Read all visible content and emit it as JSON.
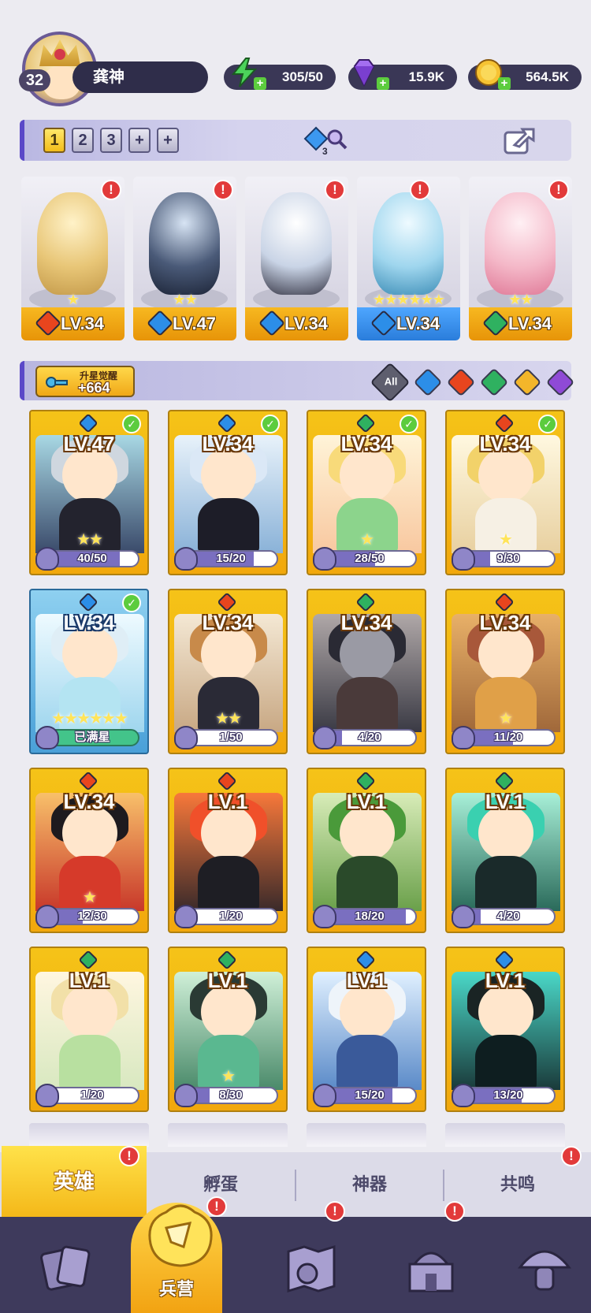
{
  "player": {
    "level": "32",
    "name": "龚神"
  },
  "resources": [
    {
      "name": "energy",
      "icon": "lightning-icon",
      "value": "305/50",
      "color": "#4cd35a"
    },
    {
      "name": "gems",
      "icon": "diamond-icon",
      "value": "15.9K",
      "color": "#9c5de6"
    },
    {
      "name": "gold",
      "icon": "coin-icon",
      "value": "564.5K",
      "color": "#f3b62a"
    }
  ],
  "team": {
    "tabs": [
      "1",
      "2",
      "3",
      "+",
      "+"
    ],
    "active_tab": "1",
    "power_badge": "3"
  },
  "lineup": [
    {
      "element": "fire",
      "stars": "★",
      "level": "LV.34",
      "bar": "gold",
      "alert": "!"
    },
    {
      "element": "water",
      "stars": "★★",
      "level": "LV.47",
      "bar": "gold",
      "alert": "!"
    },
    {
      "element": "water",
      "stars": "",
      "level": "LV.34",
      "bar": "gold",
      "alert": "!"
    },
    {
      "element": "water",
      "stars": "★★★★★★",
      "level": "LV.34",
      "bar": "blue",
      "alert": "!"
    },
    {
      "element": "wind",
      "stars": "★★",
      "level": "LV.34",
      "bar": "gold",
      "alert": "!"
    }
  ],
  "awaken": {
    "label": "升星觉醒",
    "value": "+664"
  },
  "filters": {
    "all_label": "All",
    "elements": [
      "water",
      "fire",
      "wind",
      "light",
      "dark"
    ]
  },
  "heroes": [
    {
      "element": "water",
      "level": "LV.47",
      "stars": "★★",
      "progress": "40/50",
      "ratio": 0.8,
      "checked": true
    },
    {
      "element": "water",
      "level": "LV.34",
      "stars": "",
      "progress": "15/20",
      "ratio": 0.75,
      "checked": true
    },
    {
      "element": "wind",
      "level": "LV.34",
      "stars": "★",
      "progress": "28/50",
      "ratio": 0.56,
      "checked": true
    },
    {
      "element": "fire",
      "level": "LV.34",
      "stars": "★",
      "progress": "9/30",
      "ratio": 0.3,
      "checked": true
    },
    {
      "element": "water",
      "level": "LV.34",
      "stars": "★★★★★★",
      "progress": "已满星",
      "ratio": 1,
      "checked": true,
      "full": true
    },
    {
      "element": "fire",
      "level": "LV.34",
      "stars": "★★",
      "progress": "1/50",
      "ratio": 0.02,
      "checked": false
    },
    {
      "element": "wind",
      "level": "LV.34",
      "stars": "",
      "progress": "4/20",
      "ratio": 0.2,
      "checked": false
    },
    {
      "element": "fire",
      "level": "LV.34",
      "stars": "★",
      "progress": "11/20",
      "ratio": 0.55,
      "checked": false
    },
    {
      "element": "fire",
      "level": "LV.34",
      "stars": "★",
      "progress": "12/30",
      "ratio": 0.4,
      "checked": false
    },
    {
      "element": "fire",
      "level": "LV.1",
      "stars": "",
      "progress": "1/20",
      "ratio": 0.05,
      "checked": false
    },
    {
      "element": "wind",
      "level": "LV.1",
      "stars": "",
      "progress": "18/20",
      "ratio": 0.9,
      "checked": false
    },
    {
      "element": "wind",
      "level": "LV.1",
      "stars": "",
      "progress": "4/20",
      "ratio": 0.2,
      "checked": false
    },
    {
      "element": "wind",
      "level": "LV.1",
      "stars": "",
      "progress": "1/20",
      "ratio": 0.05,
      "checked": false
    },
    {
      "element": "wind",
      "level": "LV.1",
      "stars": "★",
      "progress": "8/30",
      "ratio": 0.27,
      "checked": false
    },
    {
      "element": "water",
      "level": "LV.1",
      "stars": "",
      "progress": "15/20",
      "ratio": 0.75,
      "checked": false
    },
    {
      "element": "water",
      "level": "LV.1",
      "stars": "",
      "progress": "13/20",
      "ratio": 0.65,
      "checked": false
    }
  ],
  "subtabs": [
    {
      "label": "英雄",
      "active": true,
      "alert": "!"
    },
    {
      "label": "孵蛋",
      "active": false
    },
    {
      "label": "神器",
      "active": false
    },
    {
      "label": "共鸣",
      "active": false,
      "alert": "!"
    }
  ],
  "nav": [
    {
      "icon": "cards-icon",
      "label": ""
    },
    {
      "icon": "barracks-icon",
      "label": "兵营",
      "active": true,
      "alert": "!"
    },
    {
      "icon": "map-icon",
      "label": "",
      "alert": "!"
    },
    {
      "icon": "castle-icon",
      "label": "",
      "alert": "!"
    },
    {
      "icon": "mushroom-icon",
      "label": ""
    }
  ]
}
